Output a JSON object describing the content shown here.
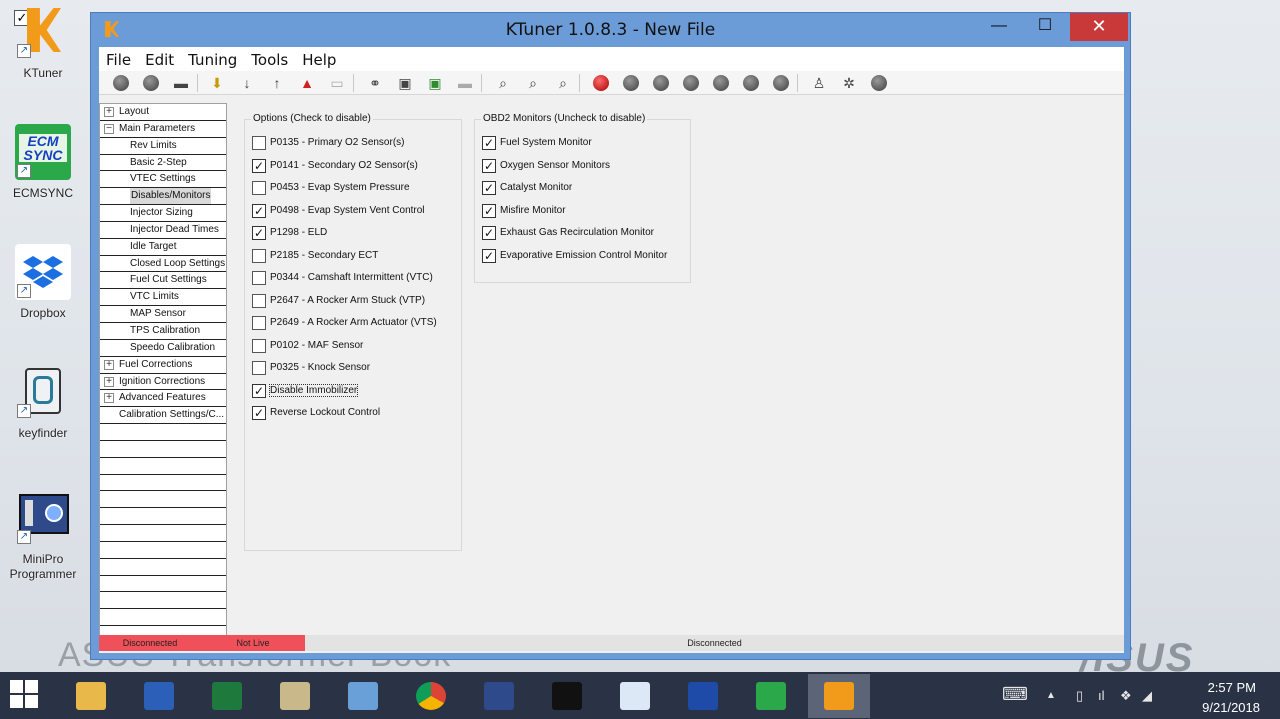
{
  "desktop": {
    "brand_left": "ASUS Transformer Book",
    "brand_right": "/ISUS",
    "icons": [
      {
        "label": "KTuner",
        "icon": "ktuner-icon"
      },
      {
        "label": "ECMSYNC",
        "icon": "ecmsync-icon"
      },
      {
        "label": "Dropbox",
        "icon": "dropbox-icon"
      },
      {
        "label": "keyfinder",
        "icon": "keyfinder-icon"
      },
      {
        "label": "MiniPro Programmer",
        "icon": "minipro-icon"
      }
    ],
    "ecmsync_logo": "ECM SYNC"
  },
  "window": {
    "title": "KTuner 1.0.8.3 - New File",
    "controls": {
      "minimize": "—",
      "maximize": "☐",
      "close": "✕"
    },
    "menu": [
      "File",
      "Edit",
      "Tuning",
      "Tools",
      "Help"
    ]
  },
  "tree": [
    {
      "label": "Layout",
      "exp": "+",
      "level": 0
    },
    {
      "label": "Main Parameters",
      "exp": "−",
      "level": 0
    },
    {
      "label": "Rev Limits",
      "level": 1
    },
    {
      "label": "Basic 2-Step",
      "level": 1
    },
    {
      "label": "VTEC Settings",
      "level": 1
    },
    {
      "label": "Disables/Monitors",
      "level": 1,
      "selected": true
    },
    {
      "label": "Injector Sizing",
      "level": 1
    },
    {
      "label": "Injector Dead Times",
      "level": 1
    },
    {
      "label": "Idle Target",
      "level": 1
    },
    {
      "label": "Closed Loop Settings",
      "level": 1
    },
    {
      "label": "Fuel Cut Settings",
      "level": 1
    },
    {
      "label": "VTC Limits",
      "level": 1
    },
    {
      "label": "MAP Sensor",
      "level": 1
    },
    {
      "label": "TPS Calibration",
      "level": 1
    },
    {
      "label": "Speedo Calibration",
      "level": 1
    },
    {
      "label": "Fuel Corrections",
      "exp": "+",
      "level": 0
    },
    {
      "label": "Ignition Corrections",
      "exp": "+",
      "level": 0
    },
    {
      "label": "Advanced Features",
      "exp": "+",
      "level": 0
    },
    {
      "label": "Calibration Settings/C...",
      "level": 0
    }
  ],
  "options_group": {
    "title": "Options (Check to disable)",
    "items": [
      {
        "label": "P0135 - Primary O2 Sensor(s)",
        "checked": false
      },
      {
        "label": "P0141 - Secondary O2 Sensor(s)",
        "checked": true
      },
      {
        "label": "P0453 - Evap System Pressure",
        "checked": false
      },
      {
        "label": "P0498 - Evap System Vent Control",
        "checked": true
      },
      {
        "label": "P1298 - ELD",
        "checked": true
      },
      {
        "label": "P2185 - Secondary ECT",
        "checked": false
      },
      {
        "label": "P0344 - Camshaft Intermittent (VTC)",
        "checked": false
      },
      {
        "label": "P2647 - A Rocker Arm Stuck (VTP)",
        "checked": false
      },
      {
        "label": "P2649 - A Rocker Arm Actuator (VTS)",
        "checked": false
      },
      {
        "label": "P0102 - MAF Sensor",
        "checked": false
      },
      {
        "label": "P0325 - Knock Sensor",
        "checked": false
      },
      {
        "label": "Disable Immobilizer",
        "checked": true,
        "focused": true
      },
      {
        "label": "Reverse Lockout Control",
        "checked": true
      }
    ]
  },
  "obd2_group": {
    "title": "OBD2 Monitors (Uncheck to disable)",
    "items": [
      {
        "label": "Fuel System Monitor",
        "checked": true
      },
      {
        "label": "Oxygen Sensor Monitors",
        "checked": true
      },
      {
        "label": "Catalyst Monitor",
        "checked": true
      },
      {
        "label": "Misfire Monitor",
        "checked": true
      },
      {
        "label": "Exhaust Gas Recirculation Monitor",
        "checked": true
      },
      {
        "label": "Evaporative Emission Control Monitor",
        "checked": true
      }
    ]
  },
  "status": {
    "connection": "Disconnected",
    "live": "Not Live",
    "right": "Disconnected",
    "colors": {
      "alert": "#f0505a"
    }
  },
  "taskbar": {
    "apps": [
      "file-explorer-icon",
      "word-icon",
      "excel-icon",
      "notepad-icon",
      "control-panel-icon",
      "chrome-icon",
      "minipro-icon",
      "chip-icon",
      "wordpad-icon",
      "sweden-flag-icon",
      "ecmsync-icon",
      "ktuner-icon"
    ],
    "time": "2:57 PM",
    "date": "9/21/2018"
  }
}
